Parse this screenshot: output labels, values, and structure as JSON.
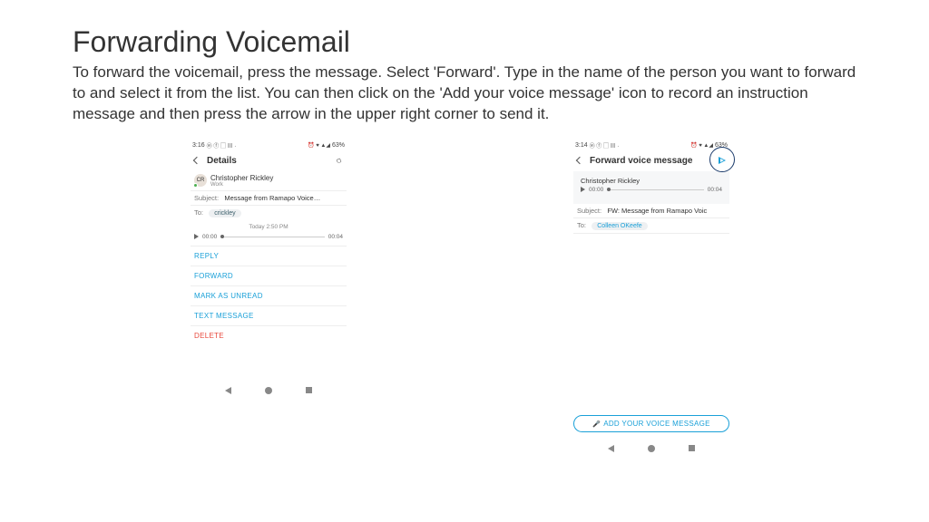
{
  "title": "Forwarding Voicemail",
  "body": "To forward the voicemail, press the message.  Select 'Forward'.  Type in the name of the person you want to forward to and select it from the list.  You can then click on the 'Add your voice message' icon to record an instruction message and then press the arrow in the upper right corner to send it.",
  "phone1": {
    "status_time": "3:16",
    "status_battery": "63%",
    "header": "Details",
    "contact_initials": "CR",
    "contact_name": "Christopher Rickley",
    "contact_sub": "Work",
    "subject_label": "Subject:",
    "subject_value": "Message from Ramapo Voice…",
    "to_label": "To:",
    "to_chip": "crickley",
    "timestamp": "Today 2:50 PM",
    "play_start": "00:00",
    "play_end": "00:04",
    "actions": {
      "reply": "REPLY",
      "forward": "FORWARD",
      "mark_unread": "MARK AS UNREAD",
      "text_message": "TEXT MESSAGE",
      "delete": "DELETE"
    }
  },
  "phone2": {
    "status_time": "3:14",
    "status_battery": "63%",
    "header": "Forward voice message",
    "contact_name": "Christopher Rickley",
    "play_start": "00:00",
    "play_end": "00:04",
    "subject_label": "Subject:",
    "subject_value": "FW: Message from Ramapo Voic",
    "to_label": "To:",
    "to_chip": "Colleen OKeefe",
    "add_voice": "ADD YOUR VOICE MESSAGE"
  }
}
